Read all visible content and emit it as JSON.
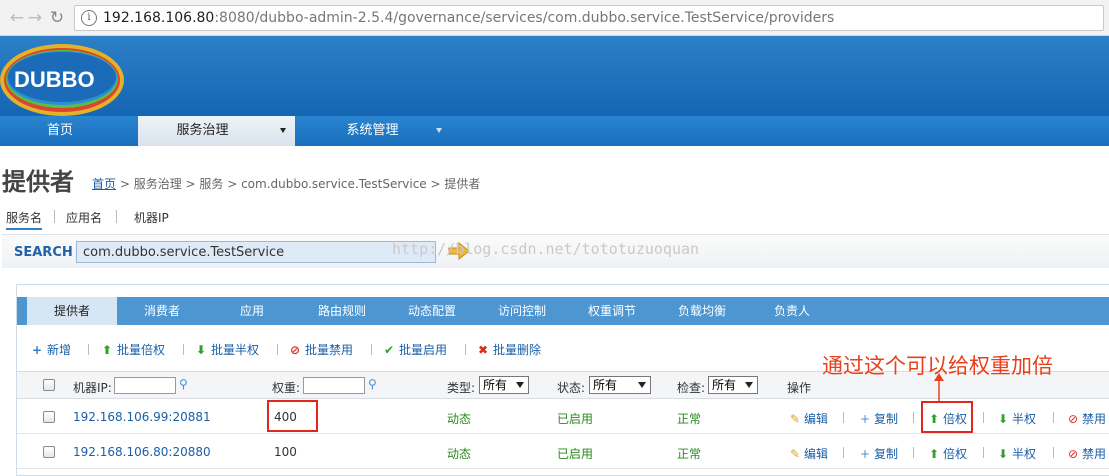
{
  "browser": {
    "url_host": "192.168.106.80",
    "url_rest": ":8080/dubbo-admin-2.5.4/governance/services/com.dubbo.service.TestService/providers"
  },
  "logo": {
    "text": "DUBBO"
  },
  "menu": [
    {
      "label": "首页"
    },
    {
      "label": "服务治理"
    },
    {
      "label": "系统管理"
    }
  ],
  "page": {
    "title": "提供者",
    "breadcrumb_home": "首页",
    "breadcrumb_rest": " > 服务治理 > 服务 > com.dubbo.service.TestService > 提供者"
  },
  "search": {
    "tabs": [
      "服务名",
      "应用名",
      "机器IP"
    ],
    "label": "SEARCH",
    "value": "com.dubbo.service.TestService"
  },
  "watermark": "http://blog.csdn.net/tototuzuoquan",
  "tabs": [
    "提供者",
    "消费者",
    "应用",
    "路由规则",
    "动态配置",
    "访问控制",
    "权重调节",
    "负载均衡",
    "负责人"
  ],
  "toolbar": [
    "新增",
    "批量倍权",
    "批量半权",
    "批量禁用",
    "批量启用",
    "批量删除"
  ],
  "table": {
    "headers": {
      "ip": "机器IP:",
      "weight": "权重:",
      "type": "类型:",
      "status": "状态:",
      "check": "检查:",
      "ops": "操作"
    },
    "filter_all": "所有",
    "rows": [
      {
        "ip": "192.168.106.99:20881",
        "weight": "400",
        "type": "动态",
        "status": "已启用",
        "check": "正常"
      },
      {
        "ip": "192.168.106.80:20880",
        "weight": "100",
        "type": "动态",
        "status": "已启用",
        "check": "正常"
      }
    ],
    "actions": [
      "编辑",
      "复制",
      "倍权",
      "半权",
      "禁用"
    ]
  },
  "annotation": "通过这个可以给权重加倍",
  "colors": {
    "brand_blue": "#1466b4",
    "tab_blue": "#4d96d2",
    "link": "#1a5fa7",
    "status_green": "#2a8a1e",
    "annotation_red": "#e8401c"
  }
}
